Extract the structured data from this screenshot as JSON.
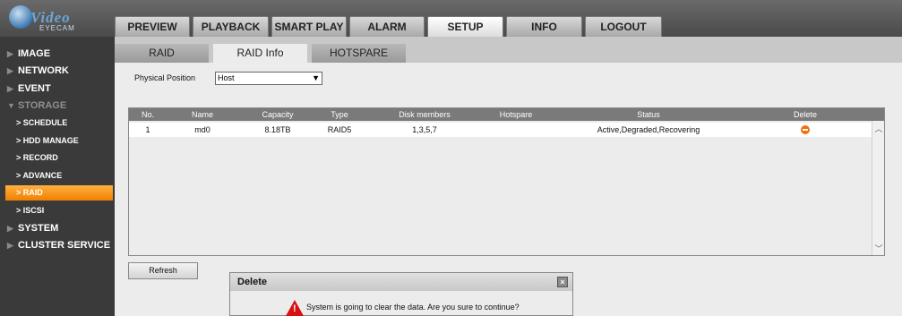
{
  "logo": {
    "word1": "Video",
    "word2": "EYECAM"
  },
  "tabs": [
    {
      "label": "PREVIEW"
    },
    {
      "label": "PLAYBACK"
    },
    {
      "label": "SMART PLAY"
    },
    {
      "label": "ALARM"
    },
    {
      "label": "SETUP"
    },
    {
      "label": "INFO"
    },
    {
      "label": "LOGOUT"
    }
  ],
  "active_tab": "SETUP",
  "sidebar": {
    "image": "IMAGE",
    "network": "NETWORK",
    "event": "EVENT",
    "storage": "STORAGE",
    "schedule": "SCHEDULE",
    "hdd_manage": "HDD MANAGE",
    "record": "RECORD",
    "advance": "ADVANCE",
    "raid": "RAID",
    "iscsi": "ISCSI",
    "system": "SYSTEM",
    "cluster": "CLUSTER SERVICE",
    "sub_prefix": ">"
  },
  "subtabs": [
    {
      "label": "RAID"
    },
    {
      "label": "RAID Info"
    },
    {
      "label": "HOTSPARE"
    }
  ],
  "active_subtab": "RAID Info",
  "physical_position": {
    "label": "Physical Position",
    "value": "Host"
  },
  "table": {
    "headers": [
      "No.",
      "Name",
      "Capacity",
      "Type",
      "Disk members",
      "Hotspare",
      "Status",
      "Delete"
    ],
    "rows": [
      {
        "no": "1",
        "name": "md0",
        "capacity": "8.18TB",
        "type": "RAID5",
        "disk_members": "1,3,5,7",
        "hotspare": "",
        "status": "Active,Degraded,Recovering"
      }
    ]
  },
  "refresh_label": "Refresh",
  "dialog": {
    "title": "Delete",
    "message": "System is going to clear the data. Are you sure to continue?",
    "close_glyph": "×"
  },
  "colors": {
    "accent_orange": "#f08000",
    "delete_icon": "#f07010",
    "warn_red": "#d81010"
  }
}
